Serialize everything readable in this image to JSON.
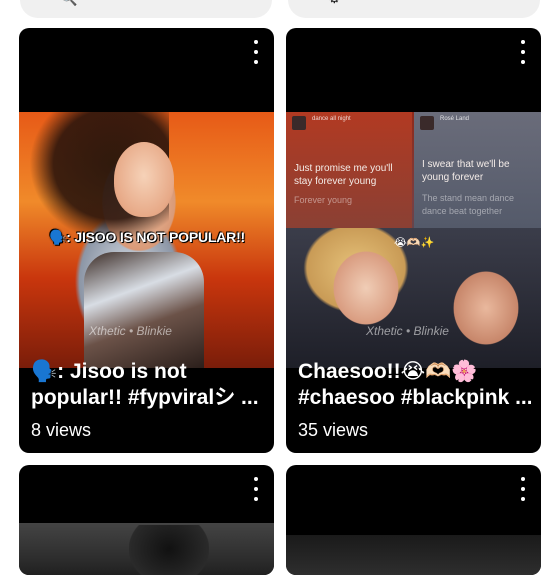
{
  "top_bar": {
    "left_glyph": "🔍",
    "right_glyph": "⚙"
  },
  "cards": [
    {
      "title_line1": "🗣️: Jisoo is not",
      "title_line2": "popular!! #fypviralシ ...",
      "views": "8 views",
      "overlay_caption": "🗣️: JISOO IS NOT POPULAR!!",
      "watermark": "Xthetic • Blinkie"
    },
    {
      "title_line1": "Chaesoo!!😭🫶🏻🌸",
      "title_line2": "#chaesoo #blackpink ...",
      "views": "35 views",
      "chat_left_header": "dance all night",
      "chat_right_header": "Rosé Land",
      "lyric_left": "Just promise me you'll stay forever young",
      "lyric_left_faint": "Forever young",
      "lyric_right": "I swear that we'll be young forever",
      "lyric_right_faint": "The stand mean dance dance beat together",
      "emojis": "😭🫶🏻✨",
      "watermark": "Xthetic • Blinkie"
    },
    {},
    {}
  ]
}
